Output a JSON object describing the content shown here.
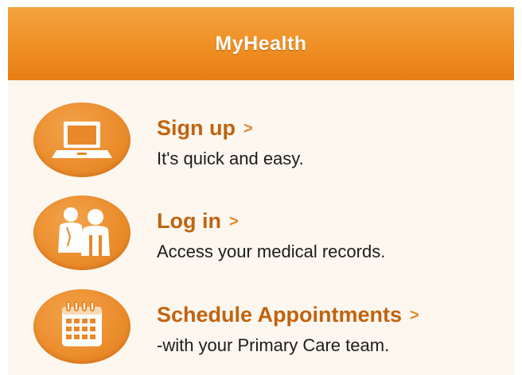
{
  "header": {
    "title": "MyHealth"
  },
  "items": [
    {
      "title": "Sign up",
      "chevron": ">",
      "description": "It's quick and easy.",
      "icon": "laptop-icon"
    },
    {
      "title": "Log in",
      "chevron": ">",
      "description": "Access your medical records.",
      "icon": "people-icon"
    },
    {
      "title": "Schedule Appointments",
      "chevron": ">",
      "description": "-with your Primary Care team.",
      "icon": "calendar-icon"
    }
  ],
  "colors": {
    "header": "#ee8f24",
    "title_text": "#c0630f",
    "icon_circle": "#ea8c2c",
    "panel_background": "#fdf7ef"
  }
}
